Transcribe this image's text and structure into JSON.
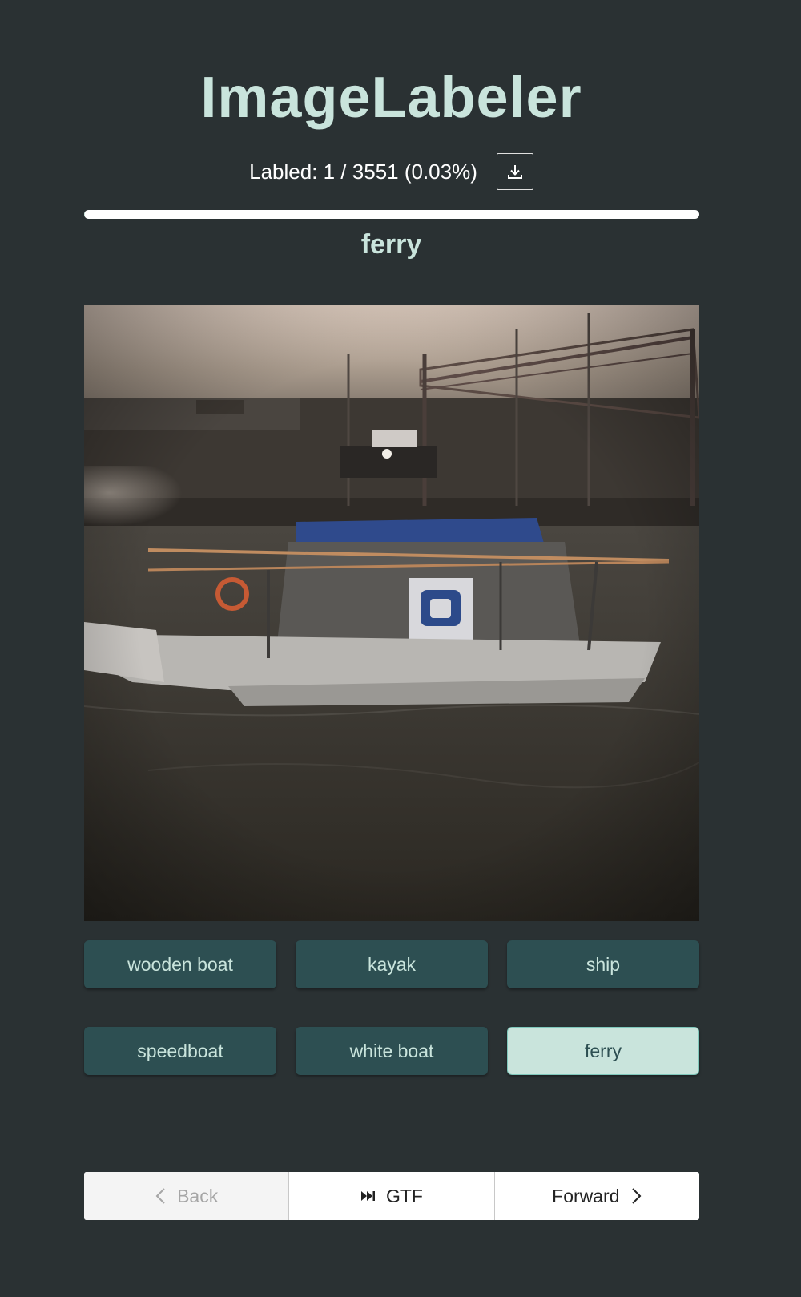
{
  "app": {
    "title": "ImageLabeler"
  },
  "progress": {
    "text": "Labled: 1 / 3551 (0.03%)",
    "labeled": 1,
    "total": 3551,
    "fraction": 0.0003,
    "download_icon": "download-icon"
  },
  "current_label": "ferry",
  "image": {
    "description_icon": "photo"
  },
  "labels": [
    {
      "label": "wooden boat",
      "selected": false
    },
    {
      "label": "kayak",
      "selected": false
    },
    {
      "label": "ship",
      "selected": false
    },
    {
      "label": "speedboat",
      "selected": false
    },
    {
      "label": "white boat",
      "selected": false
    },
    {
      "label": "ferry",
      "selected": true
    }
  ],
  "nav": {
    "back_label": "Back",
    "back_icon": "chevron-left-icon",
    "gtf_label": "GTF",
    "gtf_icon": "skip-forward-icon",
    "forward_label": "Forward",
    "forward_icon": "chevron-right-icon"
  },
  "colors": {
    "background": "#2a3133",
    "accent": "#c9e4dc",
    "button": "#2d4f52"
  }
}
